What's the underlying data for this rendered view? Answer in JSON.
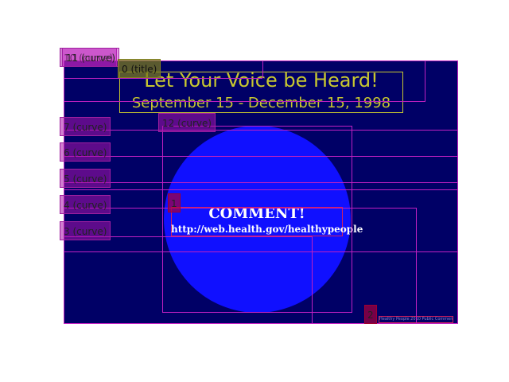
{
  "slide": {
    "title": "Let Your Voice be Heard!",
    "subtitle": "September 15 - December 15, 1998",
    "comment_heading": "COMMENT!",
    "comment_url": "http://web.health.gov/healthypeople",
    "footer_text": "Healthy People 2010 Public Comment"
  },
  "annotations": {
    "labels": [
      {
        "id": "10",
        "text": "10 (curve)",
        "kind": "curve"
      },
      {
        "id": "11",
        "text": "11 (curve)",
        "kind": "curve"
      },
      {
        "id": "0",
        "text": "0 (title)",
        "kind": "title"
      },
      {
        "id": "12",
        "text": "12 (curve)",
        "kind": "curve"
      },
      {
        "id": "7",
        "text": "7 (curve)",
        "kind": "curve"
      },
      {
        "id": "6",
        "text": "6 (curve)",
        "kind": "curve"
      },
      {
        "id": "5",
        "text": "5 (curve)",
        "kind": "curve"
      },
      {
        "id": "4",
        "text": "4 (curve)",
        "kind": "curve"
      },
      {
        "id": "3",
        "text": "3 (curve)",
        "kind": "curve"
      },
      {
        "id": "1",
        "text": "1",
        "kind": "number"
      },
      {
        "id": "2",
        "text": "2",
        "kind": "number"
      }
    ]
  },
  "colors": {
    "slide_background": "#000066",
    "circle": "#1010ff",
    "title_text": "#c8c830",
    "annotation_line": "#c020c0"
  }
}
